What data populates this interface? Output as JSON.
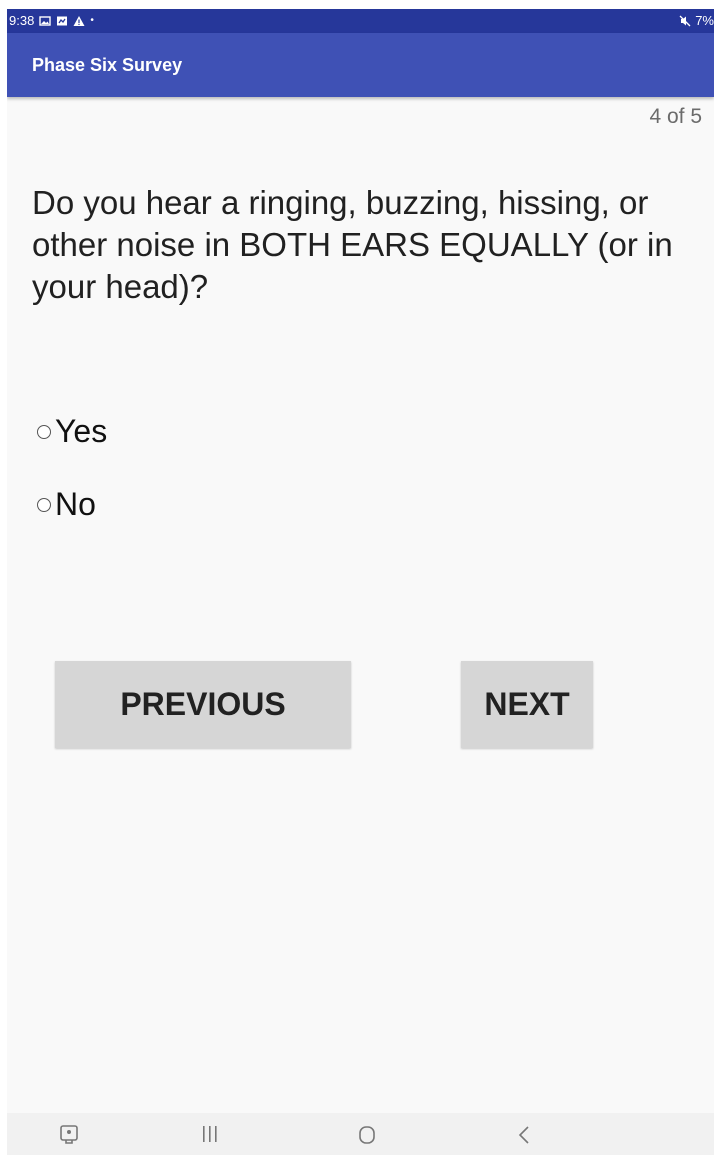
{
  "status_bar": {
    "time": "9:38",
    "battery": "7%"
  },
  "app_bar": {
    "title": "Phase Six Survey"
  },
  "progress": "4 of 5",
  "question": "Do you hear a ringing, buzzing, hissing, or other noise in BOTH EARS EQUALLY (or in your head)?",
  "options": [
    {
      "label": "Yes",
      "selected": false
    },
    {
      "label": "No",
      "selected": false
    }
  ],
  "buttons": {
    "previous": "PREVIOUS",
    "next": "NEXT"
  },
  "nav_bar": {
    "icons": [
      "screenshot-icon",
      "recent-apps-icon",
      "home-icon",
      "back-icon"
    ]
  }
}
